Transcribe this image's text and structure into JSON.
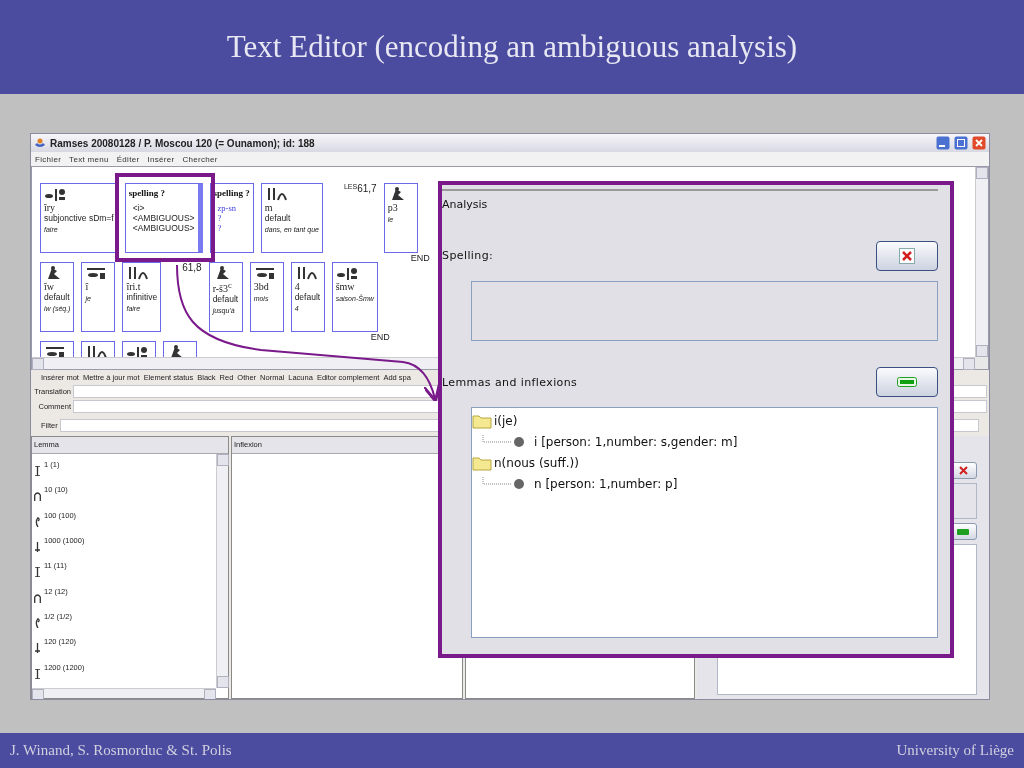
{
  "slide": {
    "title": "Text Editor (encoding an ambiguous analysis)",
    "footer_left": "J. Winand, S. Rosmorduc & St. Polis",
    "footer_right": "University of Liège"
  },
  "window": {
    "title": "Ramses 20080128 / P. Moscou 120 (= Ounamon); id: 188"
  },
  "menu": [
    "Fichier",
    "Text menu",
    "Éditer",
    "Insérer",
    "Chercher"
  ],
  "editor": {
    "rows": [
      {
        "end": "END",
        "items": [
          {
            "kind": "word",
            "selected": false,
            "translit": "îry",
            "grammar": "subjonctive sDm=f",
            "gloss": "faire"
          },
          {
            "kind": "spelling",
            "selected": true,
            "uncertain": false,
            "heading": "spelling ?",
            "lines": [
              "<i>",
              "<AMBIGUOUS>",
              "<AMBIGUOUS>"
            ]
          },
          {
            "kind": "spelling",
            "selected": false,
            "uncertain": true,
            "heading": "spelling ?",
            "lines": [
              "zp-sn",
              "?",
              "?"
            ]
          },
          {
            "kind": "word",
            "selected": false,
            "translit": "m",
            "grammar": "default",
            "gloss": "dans, en tant que"
          },
          {
            "kind": "marker",
            "sup": "LES",
            "label": "61,7"
          },
          {
            "kind": "word",
            "selected": false,
            "translit": "p3",
            "gloss": "le"
          }
        ]
      },
      {
        "end": "END",
        "items": [
          {
            "kind": "word",
            "selected": false,
            "translit": "îw",
            "grammar": "default",
            "gloss": "iw (séq.)"
          },
          {
            "kind": "word",
            "selected": false,
            "translit": "î",
            "gloss": "je"
          },
          {
            "kind": "word",
            "selected": false,
            "translit": "îri.t",
            "grammar": "infinitive",
            "gloss": "faire"
          },
          {
            "kind": "marker",
            "label": "61,8"
          },
          {
            "kind": "word",
            "selected": false,
            "translit": "r-š3$^{c}$",
            "grammar": "default",
            "gloss": "jusqu'à"
          },
          {
            "kind": "word",
            "selected": false,
            "translit": "3bd",
            "gloss": "mois"
          },
          {
            "kind": "word",
            "selected": false,
            "translit": "4",
            "grammar": "default",
            "gloss": "4"
          },
          {
            "kind": "word",
            "selected": false,
            "translit": "šmw",
            "gloss": "saison-Šmw"
          }
        ]
      },
      {
        "items": [
          {
            "kind": "word",
            "selected": false
          },
          {
            "kind": "word",
            "selected": false
          },
          {
            "kind": "word",
            "selected": false
          },
          {
            "kind": "word",
            "selected": false
          }
        ]
      }
    ]
  },
  "toolbar": [
    "Insérer mot",
    "Mettre à jour mot",
    "Element status",
    "Black",
    "Red",
    "Other",
    "Normal",
    "Lacuna",
    "Editor complement",
    "Add spa"
  ],
  "fields": [
    {
      "label": "Translation"
    },
    {
      "label": "Comment"
    }
  ],
  "filter": {
    "label": "Filter"
  },
  "lemma": {
    "header": "Lemma",
    "items": [
      "1 (1)",
      "10 (10)",
      "100 (100)",
      "1000 (1000)",
      "11 (11)",
      "12 (12)",
      "1/2  (1/2)",
      "120 (120)",
      "1200 (1200)"
    ]
  },
  "inflexion": {
    "header": "Inflexion"
  },
  "analysis": {
    "title": "Analysis",
    "spelling_label": "Spelling:",
    "lemmas_label": "Lemmas and inflexions",
    "tree": [
      {
        "label": "i(je)",
        "expanded": true,
        "children": [
          {
            "label": "i [person: 1,number: s,gender: m]"
          }
        ]
      },
      {
        "label": "n(nous (suff.))",
        "expanded": true,
        "children": [
          {
            "label": "n [person: 1,number: p]"
          }
        ]
      }
    ]
  }
}
